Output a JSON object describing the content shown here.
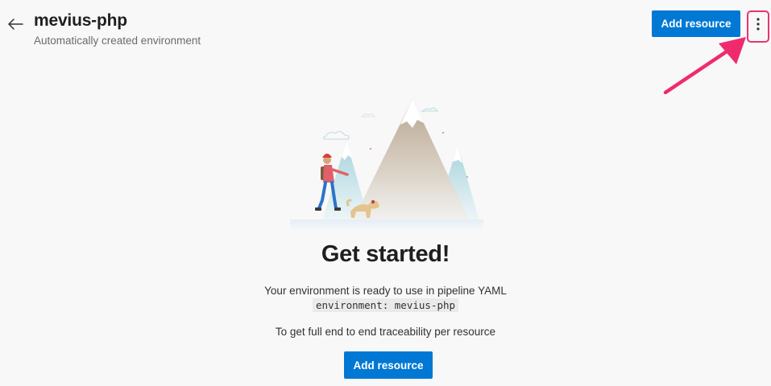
{
  "header": {
    "title": "mevius-php",
    "subtitle": "Automatically created environment",
    "add_resource_label": "Add resource",
    "back_icon": "arrow-left-icon",
    "more_icon": "more-vertical-icon"
  },
  "empty_state": {
    "heading": "Get started!",
    "ready_text": "Your environment is ready to use in pipeline YAML",
    "code_snippet": "environment: mevius-php",
    "trace_text": "To get full end to end traceability per resource",
    "add_resource_label": "Add resource"
  },
  "colors": {
    "primary": "#0078d4",
    "highlight": "#e8336f",
    "background": "#f8f8f8"
  }
}
